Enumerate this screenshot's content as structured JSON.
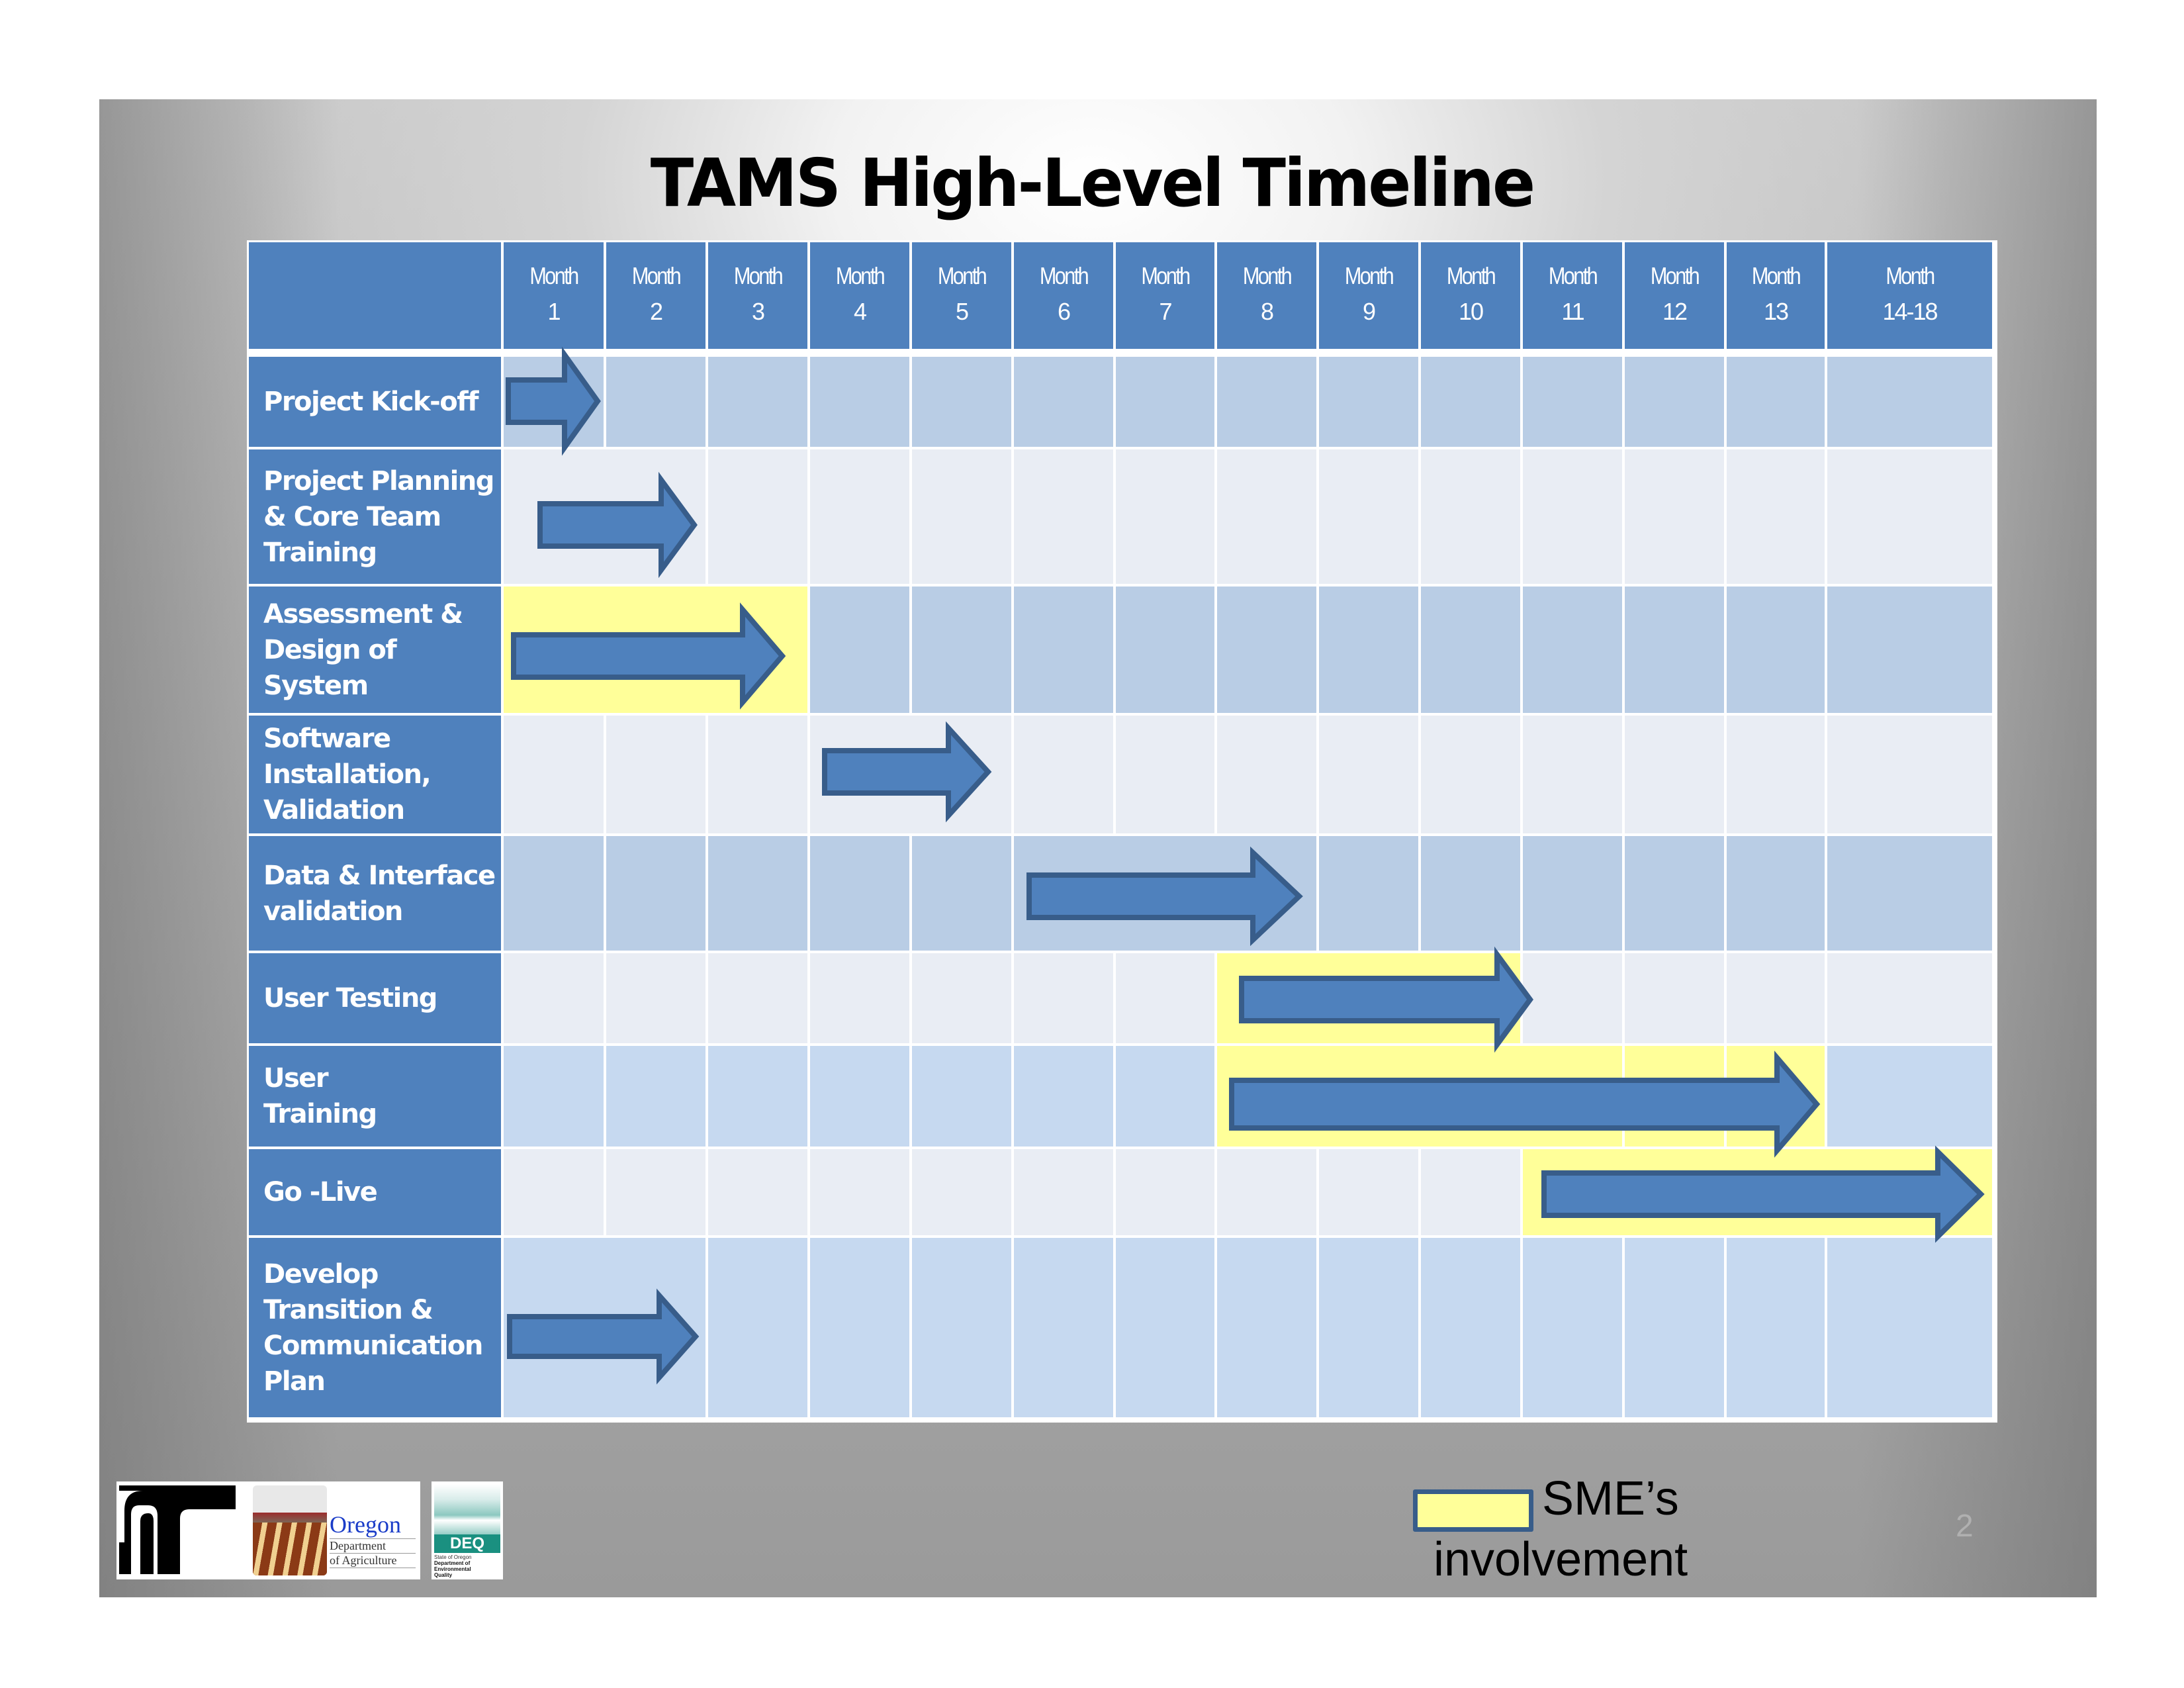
{
  "slide": {
    "title": "TAMS High-Level Timeline",
    "page_number": "2"
  },
  "legend": {
    "swatch_color": "#ffff99",
    "line1": "SME’s",
    "line2": "involvement"
  },
  "logos": [
    {
      "name": "odot-logo",
      "text": ""
    },
    {
      "name": "oda-logo",
      "title": "Oregon",
      "line2": "Department",
      "line3": "of Agriculture"
    },
    {
      "name": "deq-logo",
      "title": "DEQ",
      "line1": "State of Oregon",
      "line2": "Department of",
      "line3": "Environmental",
      "line4": "Quality"
    }
  ],
  "colors": {
    "header": "#4f81bd",
    "arrow_fill": "#4f81bd",
    "arrow_stroke": "#385d8a",
    "sme_highlight": "#ffff99",
    "row_medium": "#b9cde5",
    "row_light": "#e9edf4",
    "row_soft": "#c6d9f0"
  },
  "chart_data": {
    "type": "table",
    "subtype": "gantt",
    "title": "TAMS High-Level Timeline",
    "columns": [
      {
        "top": "Month",
        "bottom": "1"
      },
      {
        "top": "Month",
        "bottom": "2"
      },
      {
        "top": "Month",
        "bottom": "3"
      },
      {
        "top": "Month",
        "bottom": "4"
      },
      {
        "top": "Month",
        "bottom": "5"
      },
      {
        "top": "Month",
        "bottom": "6"
      },
      {
        "top": "Month",
        "bottom": "7"
      },
      {
        "top": "Month",
        "bottom": "8"
      },
      {
        "top": "Month",
        "bottom": "9"
      },
      {
        "top": "Month",
        "bottom": "10"
      },
      {
        "top": "Month",
        "bottom": "11"
      },
      {
        "top": "Month",
        "bottom": "12"
      },
      {
        "top": "Month",
        "bottom": "13"
      },
      {
        "top": "Month",
        "bottom": "14-18"
      }
    ],
    "tasks": [
      {
        "label": "Project Kick-off",
        "start": 1,
        "end": 1,
        "sme": null,
        "arrow_end": 1.9,
        "merge": []
      },
      {
        "label": "Project Planning\n& Core Team\nTraining",
        "start": 1,
        "end": 2,
        "sme": null,
        "arrow_end": 2.8,
        "merge": [
          [
            1,
            2
          ]
        ]
      },
      {
        "label": "Assessment &\nDesign of\nSystem",
        "start": 1,
        "end": 3,
        "sme": [
          1,
          3
        ],
        "arrow_end": 3.7,
        "merge": [
          [
            1,
            3
          ]
        ]
      },
      {
        "label": "Software\nInstallation,\nValidation",
        "start": 4,
        "end": 5,
        "sme": null,
        "arrow_end": 5.8,
        "merge": [
          [
            4,
            5
          ]
        ]
      },
      {
        "label": "Data & Interface\nvalidation",
        "start": 6,
        "end": 8,
        "sme": null,
        "arrow_end": 8.8,
        "merge": [
          [
            6,
            8
          ]
        ]
      },
      {
        "label": "User Testing",
        "start": 8,
        "end": 10,
        "sme": [
          8,
          10
        ],
        "arrow_end": 10.1,
        "merge": [
          [
            8,
            10
          ]
        ]
      },
      {
        "label": "User\nTraining",
        "start": 8,
        "end": 13,
        "sme": [
          8,
          13
        ],
        "arrow_end": 13.9,
        "merge": [
          [
            8,
            11
          ]
        ]
      },
      {
        "label": "Go -Live",
        "start": 11,
        "end": 14,
        "sme": [
          11,
          14
        ],
        "arrow_end": 14.9,
        "merge": [
          [
            11,
            14
          ]
        ]
      },
      {
        "label": "Develop\nTransition &\nCommunication\nPlan",
        "start": 1,
        "end": 2,
        "sme": null,
        "arrow_end": 2.8,
        "merge": [
          [
            1,
            2
          ]
        ]
      }
    ],
    "legend": [
      {
        "label": "SME’s involvement",
        "color": "#ffff99"
      }
    ]
  }
}
